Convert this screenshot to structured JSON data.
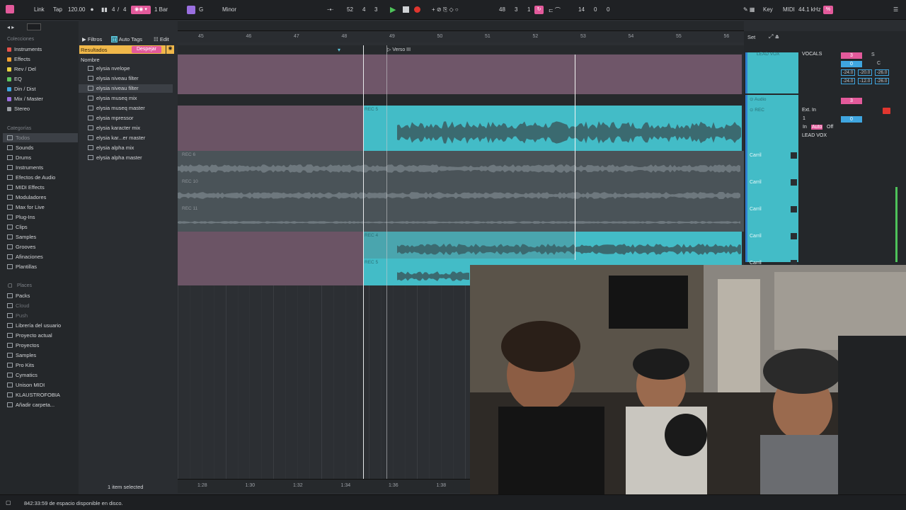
{
  "transport": {
    "link": "Link",
    "tap": "Tap",
    "tempo": "120.00",
    "signature_num": "4",
    "signature_sep": "/",
    "signature_den": "4",
    "quant": "1 Bar",
    "key": "G",
    "scale": "Minor",
    "position": [
      "52",
      "4",
      "3"
    ],
    "loop_start": [
      "48",
      "3",
      "1"
    ],
    "loop_len": [
      "14",
      "0",
      "0"
    ],
    "key_label": "Key",
    "midi_label": "MIDI",
    "sample_rate": "44.1 kHz",
    "cpu": "%"
  },
  "browser": {
    "collections_header": "Colecciones",
    "collections": [
      {
        "label": "Instruments",
        "color": "#e8534a"
      },
      {
        "label": "Effects",
        "color": "#f0a030"
      },
      {
        "label": "Rev / Del",
        "color": "#e8d040"
      },
      {
        "label": "EQ",
        "color": "#5fc660"
      },
      {
        "label": "Din / Dist",
        "color": "#3fa6e0"
      },
      {
        "label": "Mix / Master",
        "color": "#9a6fe0"
      },
      {
        "label": "Stereo",
        "color": "#9a9ea4"
      }
    ],
    "categories_header": "Categorías",
    "categories": [
      "Todos",
      "Sounds",
      "Drums",
      "Instruments",
      "Efectos de Audio",
      "MIDI Effects",
      "Moduladores",
      "Max for Live",
      "Plug-Ins",
      "Clips",
      "Samples",
      "Grooves",
      "Afinaciones",
      "Plantillas"
    ],
    "places_header": "Places",
    "places": [
      "Packs",
      "Cloud",
      "Push",
      "Librería del usuario",
      "Proyecto actual",
      "Proyectos",
      "Samples",
      "Pro Kits",
      "Cymatics",
      "Unison MIDI",
      "KLAUSTROFOBIA",
      "Añadir carpeta..."
    ],
    "search_placeholder": "",
    "filter_label": "Filtros",
    "autotags_label": "Auto Tags",
    "edit_label": "Edit",
    "results_label": "Resultados",
    "clear_label": "Despejar",
    "name_header": "Nombre",
    "results": [
      "elysia nvelope",
      "elysia niveau filter",
      "elysia niveau filter",
      "elysia museq mix",
      "elysia museq master",
      "elysia mpressor",
      "elysia karacter mix",
      "elysia kar...er master",
      "elysia alpha mix",
      "elysia alpha master"
    ],
    "selected_count": "1 item selected"
  },
  "arrangement": {
    "bars": [
      "45",
      "46",
      "47",
      "48",
      "49",
      "50",
      "51",
      "52",
      "53",
      "54",
      "55",
      "56"
    ],
    "locator": "Verso III",
    "clip_labels": [
      "REC 5",
      "REC 6",
      "REC 10",
      "REC 11",
      "REC 4",
      "REC 5"
    ],
    "times": [
      "1:28",
      "1:30",
      "1:32",
      "1:34",
      "1:36",
      "1:38"
    ]
  },
  "mixer": {
    "set_label": "Set",
    "track_lead": "LEAD VOX",
    "vocals": "VOCALS",
    "audio": "Audio",
    "rec": "REC",
    "ext_in": "Ext. In",
    "in": "In",
    "auto": "Auto",
    "off": "Off",
    "lead_vox_out": "LEAD VOX",
    "carril": [
      "Carril",
      "Carril",
      "Carril",
      "Carril",
      "Carril"
    ],
    "values": [
      "-24.0",
      "-20.0",
      "-26.0",
      "-24.0",
      "-12.0",
      "-26.0"
    ],
    "num_3": "3",
    "num_0": "0",
    "letter_c": "C",
    "letter_s": "S",
    "num_1": "1"
  },
  "status": {
    "disk": "842:33:59 de espacio disponible en disco."
  }
}
